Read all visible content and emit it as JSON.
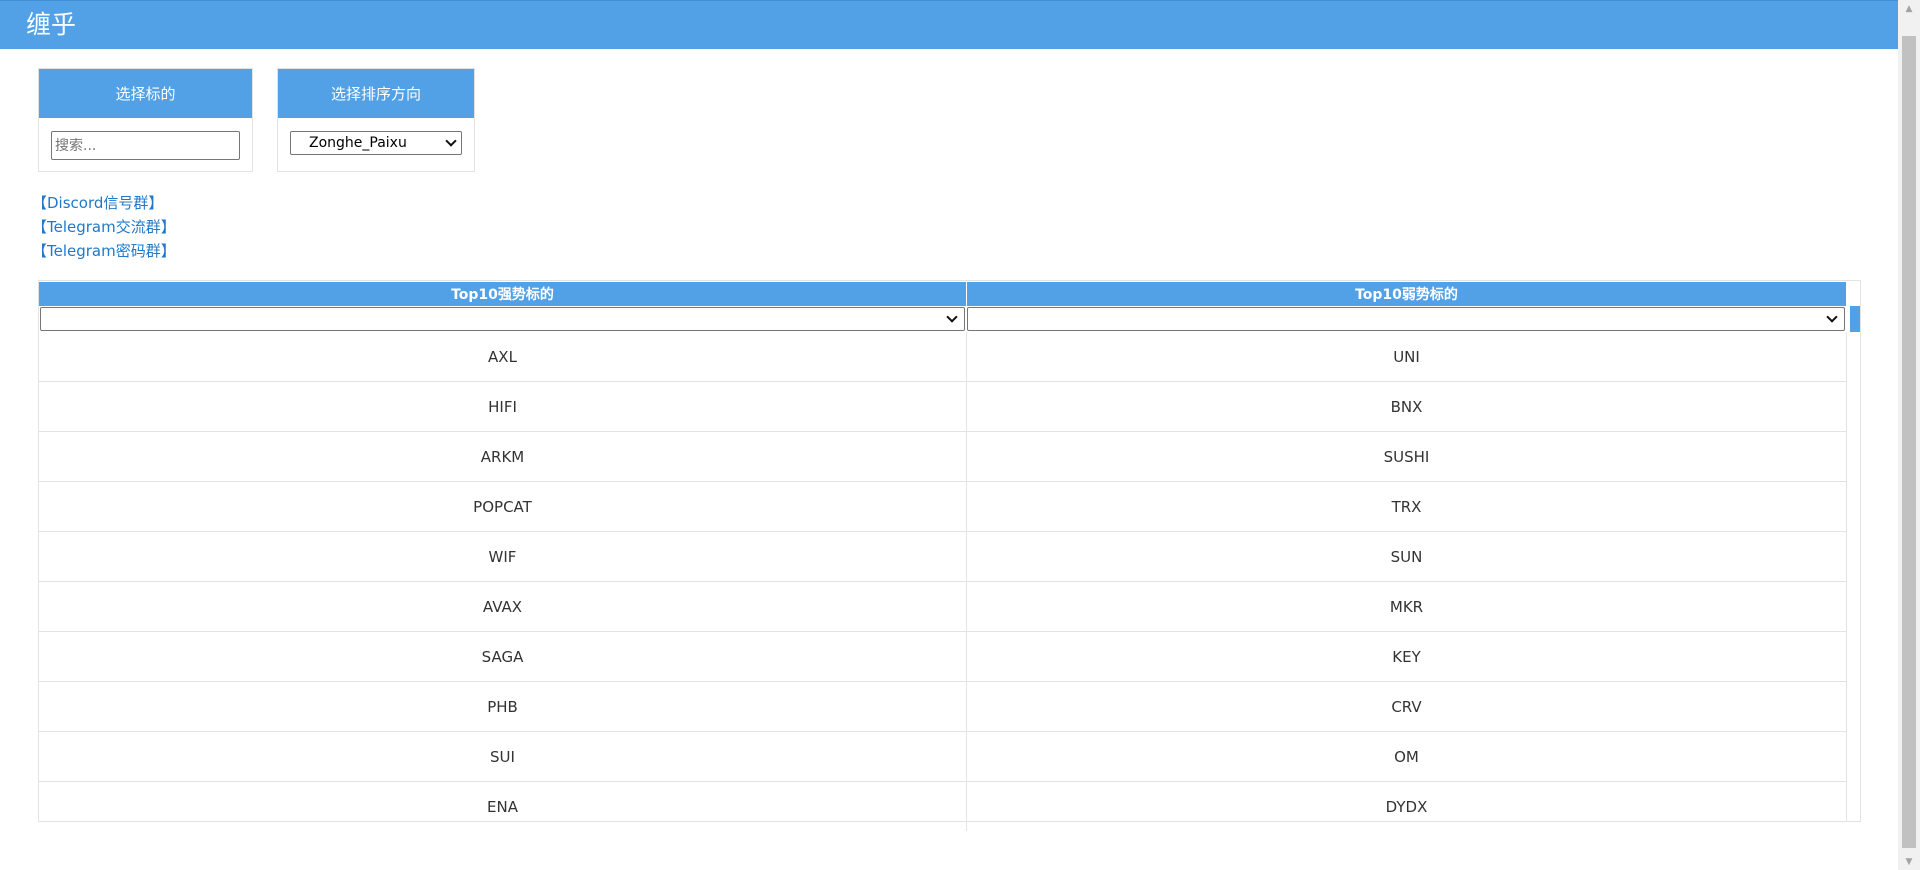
{
  "header": {
    "title": "缠乎"
  },
  "filters": {
    "symbol": {
      "label": "选择标的",
      "placeholder": "搜索..."
    },
    "sort": {
      "label": "选择排序方向",
      "value": "Zonghe_Paixu"
    }
  },
  "links": [
    "【Discord信号群】",
    "【Telegram交流群】",
    "【Telegram密码群】"
  ],
  "table": {
    "columns": [
      "Top10强势标的",
      "Top10弱势标的"
    ],
    "rows": [
      [
        "AXL",
        "UNI"
      ],
      [
        "HIFI",
        "BNX"
      ],
      [
        "ARKM",
        "SUSHI"
      ],
      [
        "POPCAT",
        "TRX"
      ],
      [
        "WIF",
        "SUN"
      ],
      [
        "AVAX",
        "MKR"
      ],
      [
        "SAGA",
        "KEY"
      ],
      [
        "PHB",
        "CRV"
      ],
      [
        "SUI",
        "OM"
      ],
      [
        "ENA",
        "DYDX"
      ]
    ]
  },
  "colors": {
    "accent": "#52a0e5",
    "link": "#1f78c8",
    "border": "#e3e3e3"
  }
}
